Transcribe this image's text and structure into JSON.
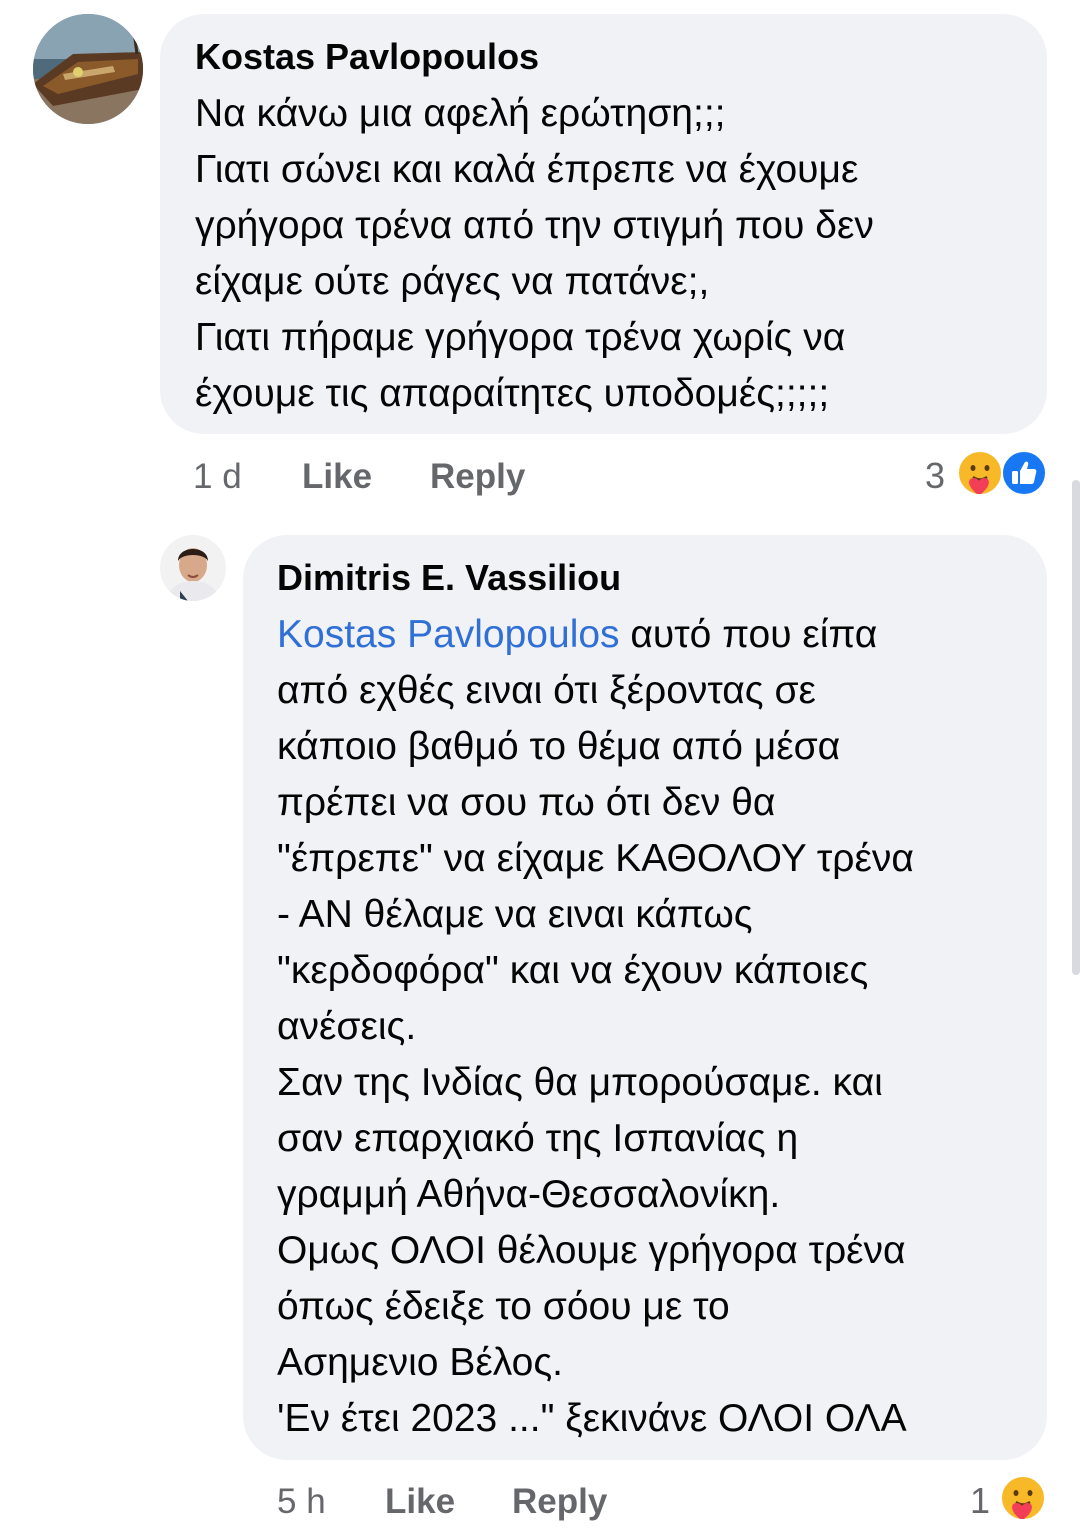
{
  "comments": [
    {
      "author": "Kostas Pavlopoulos",
      "lines": [
        "Να κάνω μια αφελή ερώτηση;;;",
        "Γιατι σώνει και καλά έπρεπε να έχουμε",
        "γρήγορα τρένα από την στιγμή που δεν",
        "είχαμε ούτε ράγες να  πατάνε;,",
        "Γιατι πήραμε γρήγορα τρένα χωρίς να",
        "έχουμε τις απαραίτητες υποδομές;;;;;"
      ],
      "time": "1 d",
      "like_label": "Like",
      "reply_label": "Reply",
      "reaction_count": "3",
      "reactions": [
        "care-icon",
        "like-icon"
      ]
    },
    {
      "author": "Dimitris E. Vassiliou",
      "mention": "Kostas Pavlopoulos",
      "first_line_rest": " αυτό που είπα",
      "lines": [
        "από εχθές ειναι ότι ξέροντας σε",
        "κάποιο βαθμό το θέμα από μέσα",
        "πρέπει να σου πω ότι δεν θα",
        "\"έπρεπε\" να είχαμε ΚΑΘΟΛΟΥ τρένα",
        "- ΑΝ θέλαμε να ειναι κάπως",
        "\"κερδοφόρα\" και να έχουν κάποιες",
        "ανέσεις.",
        "Σαν της Ινδίας θα μπορούσαμε. και",
        "σαν επαρχιακό της Ισπανίας η",
        "γραμμή Αθήνα-Θεσσαλονίκη.",
        "Ομως ΟΛΟΙ θέλουμε γρήγορα τρένα",
        "όπως έδειξε το σόου με το",
        "Ασημενιο Βέλος.",
        "'Εν έτει 2023 ...\" ξεκινάνε ΟΛΟΙ ΟΛΑ"
      ],
      "time": "5 h",
      "like_label": "Like",
      "reply_label": "Reply",
      "reaction_count": "1",
      "reactions": [
        "care-icon"
      ]
    }
  ],
  "colors": {
    "bubble": "#f0f2f5",
    "mention": "#2f6fd6",
    "meta": "#65676b",
    "like_blue": "#1877f2",
    "care_yellow": "#f7b928"
  }
}
